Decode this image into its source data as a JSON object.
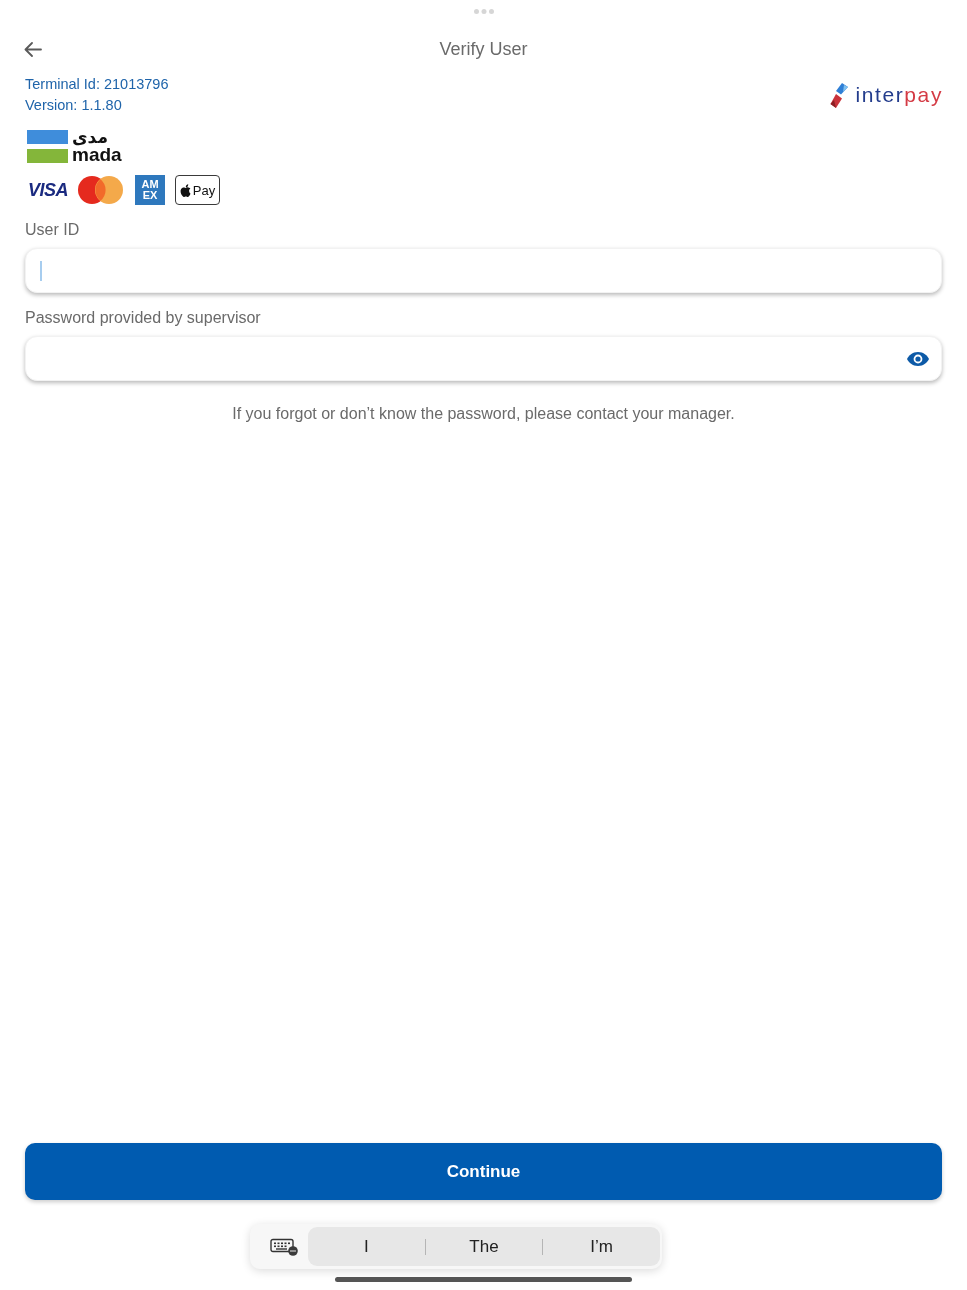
{
  "top_bar": {
    "title": "Verify User"
  },
  "terminal": {
    "terminal_id": "Terminal Id: 21013796",
    "version": "Version: 1.1.80"
  },
  "brand_logo": {
    "first": "inter",
    "second": "pay"
  },
  "payment_logos": [
    {
      "kind": "mada",
      "arabic": "مدى",
      "latin": "mada"
    },
    {
      "kind": "visa",
      "latin": "VISA"
    },
    {
      "kind": "mastercard"
    },
    {
      "kind": "amex",
      "lines": [
        "AM",
        "EX"
      ]
    },
    {
      "kind": "applepay",
      "latin": "Pay"
    }
  ],
  "form": {
    "fields": [
      {
        "label": "User ID",
        "kind": "text",
        "focused": true
      },
      {
        "label": "Password provided by supervisor",
        "kind": "password",
        "focused": false
      }
    ],
    "hint": "If you forgot or don’t know the password, please contact your manager."
  },
  "continue_button": {
    "label": "Continue"
  },
  "keyboard_bar": {
    "suggestions": [
      "I",
      "The",
      "I’m"
    ]
  }
}
